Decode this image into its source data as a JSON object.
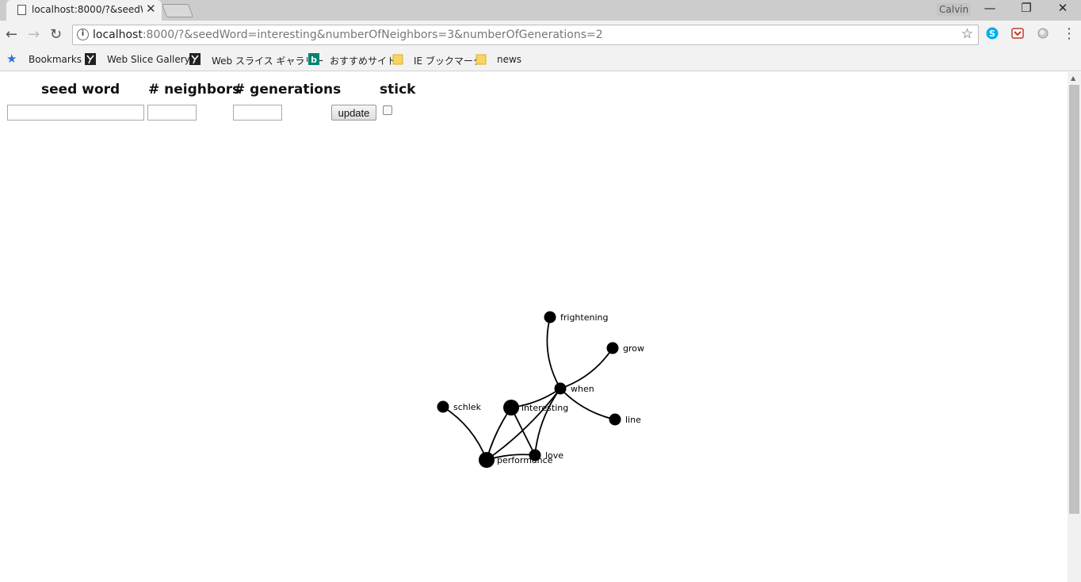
{
  "browser": {
    "tab_title": "localhost:8000/?&seedWord=interesting&numberOfNeighbors=3&numberOfGenerations=2",
    "profile_name": "Calvin",
    "url_host": "localhost",
    "url_rest": ":8000/?&seedWord=interesting&numberOfNeighbors=3&numberOfGenerations=2",
    "bookmarks": [
      "Bookmarks",
      "Web Slice Gallery",
      "Web スライス ギャラリー",
      "おすすめサイト",
      "IE ブックマーク",
      "news"
    ]
  },
  "form": {
    "seed_word_header": "seed word",
    "neighbors_header": "# neighbors",
    "generations_header": "# generations",
    "stick_header": "stick",
    "seed_word_value": "",
    "neighbors_value": "",
    "generations_value": "",
    "update_label": "update",
    "stick_checked": false
  },
  "graph": {
    "nodes": [
      {
        "id": "frightening",
        "label": "frightening",
        "seed": false
      },
      {
        "id": "grow",
        "label": "grow",
        "seed": false
      },
      {
        "id": "when",
        "label": "when",
        "seed": false
      },
      {
        "id": "schlek",
        "label": "schlek",
        "seed": false
      },
      {
        "id": "interesting",
        "label": "interesting",
        "seed": true
      },
      {
        "id": "line",
        "label": "line",
        "seed": false
      },
      {
        "id": "love",
        "label": "love",
        "seed": false
      },
      {
        "id": "performance",
        "label": "performance",
        "seed": true
      }
    ],
    "links": [
      [
        "when",
        "frightening"
      ],
      [
        "when",
        "grow"
      ],
      [
        "when",
        "line"
      ],
      [
        "when",
        "interesting"
      ],
      [
        "when",
        "love"
      ],
      [
        "when",
        "performance"
      ],
      [
        "interesting",
        "love"
      ],
      [
        "interesting",
        "performance"
      ],
      [
        "performance",
        "love"
      ],
      [
        "performance",
        "schlek"
      ]
    ]
  }
}
